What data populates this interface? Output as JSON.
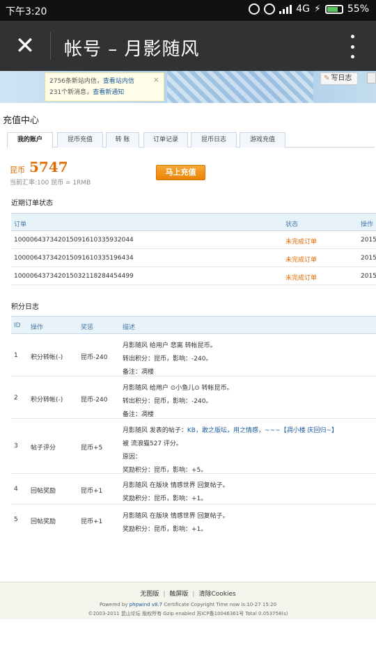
{
  "status_bar": {
    "time": "下午3:20",
    "network": "4G",
    "battery": "55%"
  },
  "app_bar": {
    "title": "帐号 – 月影随风"
  },
  "notice": {
    "line1_prefix": "2756条新站内信，",
    "line1_link": "查看站内信",
    "line2_prefix": "231个新消息，",
    "line2_link": "查看新通知"
  },
  "write_log": "写日志",
  "page_title": "充值中心",
  "tabs": [
    "我的账户",
    "昆币充值",
    "转 账",
    "订单记录",
    "昆币日志",
    "游戏充值"
  ],
  "balance": {
    "label": "昆币",
    "value": "5747",
    "rate": "当前汇率:100 昆币 = 1RMB"
  },
  "recharge_button": "马上充值",
  "orders": {
    "heading": "近期订单状态",
    "columns": [
      "订单",
      "状态",
      "操作"
    ],
    "rows": [
      {
        "order": "100006437342015091610335932044",
        "status": "未完成订单",
        "action": "2015"
      },
      {
        "order": "100006437342015091610335196434",
        "status": "未完成订单",
        "action": "2015"
      },
      {
        "order": "100006437342015032118284454499",
        "status": "未完成订单",
        "action": "2015"
      }
    ]
  },
  "points": {
    "heading": "积分日志",
    "columns": [
      "ID",
      "操作",
      "奖惩",
      "描述"
    ],
    "rows": [
      {
        "id": "1",
        "op": "积分转帐(-)",
        "reward": "昆币-240",
        "desc": [
          "月影随风 给用户 悲离 转帐昆币。",
          "转出积分：昆币，影响：-240。",
          "备注：凋楼"
        ]
      },
      {
        "id": "2",
        "op": "积分转帐(-)",
        "reward": "昆币-240",
        "desc": [
          "月影随风 给用户 ⊙小鱼儿⊙ 转帐昆币。",
          "转出积分：昆币，影响：-240。",
          "备注：凋楼"
        ]
      },
      {
        "id": "3",
        "op": "帖子评分",
        "reward": "昆币+5",
        "desc_a": "月影随风 发表的帖子：",
        "desc_link": "KB，敢之版坛，用之情感，~~~【凋小楼 庆回归~】",
        "desc": [
          "被 流浪猫527 评分。",
          "原因：",
          "奖励积分：昆币，影响：+5。"
        ]
      },
      {
        "id": "4",
        "op": "回帖奖励",
        "reward": "昆币+1",
        "desc": [
          "月影随风 在版块 情感世界 回复帖子。",
          "奖励积分：昆币，影响：+1。"
        ]
      },
      {
        "id": "5",
        "op": "回帖奖励",
        "reward": "昆币+1",
        "desc": [
          "月影随风 在版块 情感世界 回复帖子。",
          "奖励积分：昆币，影响：+1。"
        ]
      }
    ]
  },
  "footer": {
    "links": [
      "无图版",
      "触屏版",
      "清除Cookies"
    ],
    "powered_prefix": "Powered by ",
    "powered_brand": "phpwind v8.7",
    "powered_rest": " Certificate Copyright Time now is:10-27 15:20",
    "copyright": "©2003-2011 昆山论坛 版权所有 Gzip enabled 苏ICP备10046361号 Total 0.053758(s)"
  },
  "icons": {
    "close": "close-icon",
    "more": "more-vertical-icon",
    "signal": "signal-icon",
    "battery": "battery-icon",
    "alarm": "alarm-icon",
    "mute": "mute-icon"
  }
}
